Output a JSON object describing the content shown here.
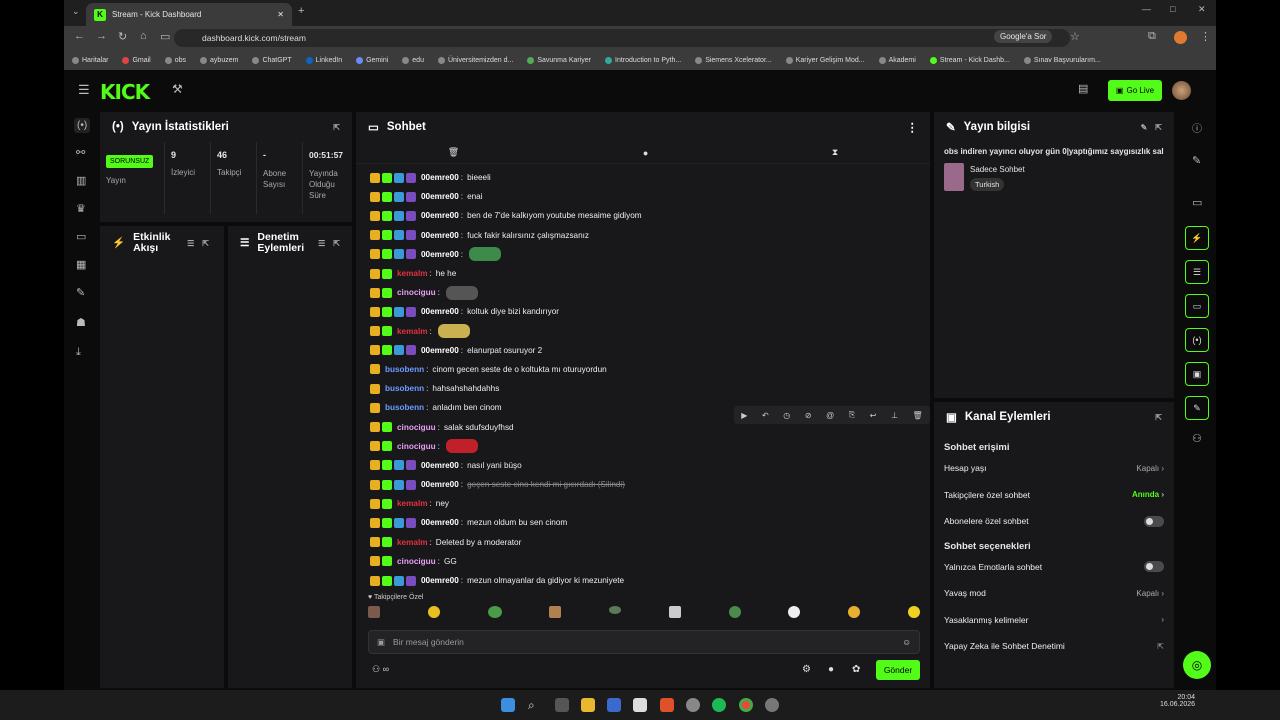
{
  "browser": {
    "tab_title": "Stream - Kick Dashboard",
    "url": "dashboard.kick.com/stream",
    "google_btn": "Google'a Sor",
    "bookmarks": [
      "Haritalar",
      "Gmail",
      "obs",
      "aybuzem",
      "ChatGPT",
      "LinkedIn",
      "Gemini",
      "edu",
      "Üniversitemizden d...",
      "Savunma Kariyer",
      "Introduction to Pyth...",
      "Siemens Xcelerator...",
      "Kariyer Gelişim Mod...",
      "Akademi",
      "Stream - Kick Dashb...",
      "Sınav Başvurularım..."
    ]
  },
  "app": {
    "logo": "KICK",
    "go_live": "Go Live"
  },
  "stats": {
    "title": "Yayın İstatistikleri",
    "badge": "SORUNSUZ",
    "badge_label": "Yayın",
    "viewers": "9",
    "viewers_label": "İzleyici",
    "followers": "46",
    "followers_label": "Takipçi",
    "subs": "-",
    "subs_label": "Abone Sayısı",
    "uptime": "00:51:57",
    "uptime_label": "Yayında Olduğu Süre"
  },
  "activity": {
    "title": "Etkinlik Akışı"
  },
  "moderation": {
    "title": "Denetim Eylemleri"
  },
  "chat": {
    "title": "Sohbet",
    "followers_only": "Takipçilere Özel",
    "input_placeholder": "Bir mesaj gönderin",
    "send": "Gönder",
    "messages": [
      {
        "user": "00emre00",
        "color": "#ffffff",
        "badges": 4,
        "text": "bieeeli"
      },
      {
        "user": "00emre00",
        "color": "#ffffff",
        "badges": 4,
        "text": "enai"
      },
      {
        "user": "00emre00",
        "color": "#ffffff",
        "badges": 4,
        "text": "ben de 7'de kalkıyom youtube mesaime gidiyom"
      },
      {
        "user": "00emre00",
        "color": "#ffffff",
        "badges": 4,
        "text": "fuck fakir kalırsınız çalışmazsanız"
      },
      {
        "user": "00emre00",
        "color": "#ffffff",
        "badges": 4,
        "text": "",
        "emote": "#3d8a4a"
      },
      {
        "user": "kemalm",
        "color": "#e0323f",
        "badges": 2,
        "text": "he he"
      },
      {
        "user": "cinociguu",
        "color": "#e99df5",
        "badges": 2,
        "text": "",
        "emote": "#555"
      },
      {
        "user": "00emre00",
        "color": "#ffffff",
        "badges": 4,
        "text": "koltuk diye bizi kandırıyor"
      },
      {
        "user": "kemalm",
        "color": "#e0323f",
        "badges": 2,
        "text": "",
        "emote": "#c9b050"
      },
      {
        "user": "00emre00",
        "color": "#ffffff",
        "badges": 4,
        "text": "elanurpat osuruyor 2"
      },
      {
        "user": "busobenn",
        "color": "#6b9cff",
        "badges": 1,
        "text": "cinom gecen seste de o koltukta mı oturuyordun"
      },
      {
        "user": "busobenn",
        "color": "#6b9cff",
        "badges": 1,
        "text": "hahsahshahdahhs"
      },
      {
        "user": "busobenn",
        "color": "#6b9cff",
        "badges": 1,
        "text": "anladım ben cinom"
      },
      {
        "user": "cinociguu",
        "color": "#e99df5",
        "badges": 2,
        "text": "salak sdufsduyfhsd"
      },
      {
        "user": "cinociguu",
        "color": "#e99df5",
        "badges": 2,
        "text": "",
        "emote": "#c0202a"
      },
      {
        "user": "00emre00",
        "color": "#ffffff",
        "badges": 4,
        "text": "nasıl yani büşo"
      },
      {
        "user": "00emre00",
        "color": "#ffffff",
        "badges": 4,
        "text": "geçen seste cino kendi mi gıcırdadı (Silindi)",
        "deleted": true
      },
      {
        "user": "kemalm",
        "color": "#e0323f",
        "badges": 2,
        "text": "ney"
      },
      {
        "user": "00emre00",
        "color": "#ffffff",
        "badges": 4,
        "text": "mezun oldum bu sen cinom"
      },
      {
        "user": "kemalm",
        "color": "#e0323f",
        "badges": 2,
        "text": "Deleted by a moderator"
      },
      {
        "user": "cinociguu",
        "color": "#e99df5",
        "badges": 2,
        "text": "GG"
      },
      {
        "user": "00emre00",
        "color": "#ffffff",
        "badges": 4,
        "text": "mezun olmayanlar da gidiyor ki mezuniyete"
      }
    ]
  },
  "stream_info": {
    "title": "Yayın bilgisi",
    "stream_title": "obs indiren yayıncı oluyor gün 0|yaptığımız saygısızlık sal",
    "category": "Sadece Sohbet",
    "language": "Turkish"
  },
  "channel_actions": {
    "title": "Kanal Eylemleri",
    "access_title": "Sohbet erişimi",
    "options_title": "Sohbet seçenekleri",
    "account_age": "Hesap yaşı",
    "account_age_val": "Kapalı",
    "followers_chat": "Takipçilere özel sohbet",
    "followers_chat_val": "Anında",
    "subs_chat": "Abonelere özel sohbet",
    "emote_only": "Yalnızca Emotlarla sohbet",
    "slow_mode": "Yavaş mod",
    "slow_mode_val": "Kapalı",
    "banned_words": "Yasaklanmış kelimeler",
    "ai_mod": "Yapay Zeka ile Sohbet Denetimi"
  },
  "clock": {
    "time": "20:04",
    "date": "16.06.2026"
  }
}
